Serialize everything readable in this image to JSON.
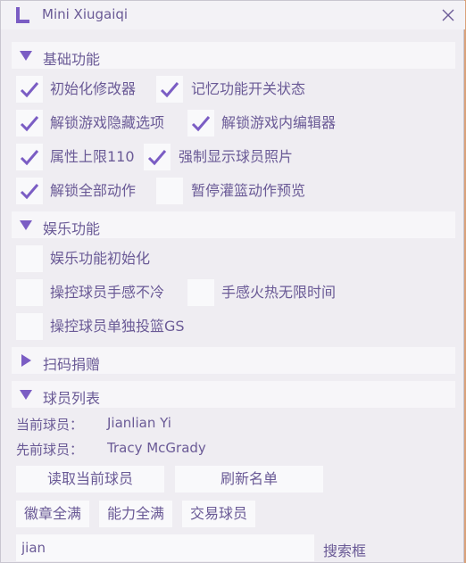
{
  "window": {
    "title": "Mini Xiugaiqi",
    "accent_color": "#7b5dc4",
    "text_color": "#6a5a96"
  },
  "sections": {
    "basic": {
      "label": "基础功能",
      "expanded": true
    },
    "fun": {
      "label": "娱乐功能",
      "expanded": true
    },
    "donate": {
      "label": "扫码捐赠",
      "expanded": false
    },
    "players": {
      "label": "球员列表",
      "expanded": true
    }
  },
  "basic_options": [
    {
      "label": "初始化修改器",
      "checked": true
    },
    {
      "label": "记忆功能开关状态",
      "checked": true
    },
    {
      "label": "解锁游戏隐藏选项",
      "checked": true
    },
    {
      "label": "解锁游戏内编辑器",
      "checked": true
    },
    {
      "label": "属性上限110",
      "checked": true
    },
    {
      "label": "强制显示球员照片",
      "checked": true
    },
    {
      "label": "解锁全部动作",
      "checked": true
    },
    {
      "label": "暂停灌篮动作预览",
      "checked": false
    }
  ],
  "fun_options": [
    {
      "label": "娱乐功能初始化",
      "checked": false
    },
    {
      "label": "操控球员手感不冷",
      "checked": false
    },
    {
      "label": "手感火热无限时间",
      "checked": false
    },
    {
      "label": "操控球员单独投篮GS",
      "checked": false
    }
  ],
  "players": {
    "current_label": "当前球员：",
    "current_value": "Jianlian Yi",
    "previous_label": "先前球员：",
    "previous_value": "Tracy McGrady",
    "read_button": "读取当前球员",
    "refresh_button": "刷新名单",
    "badges_button": "徽章全满",
    "ability_button": "能力全满",
    "trade_button": "交易球员",
    "search_value": "jian",
    "search_label": "搜索框"
  }
}
